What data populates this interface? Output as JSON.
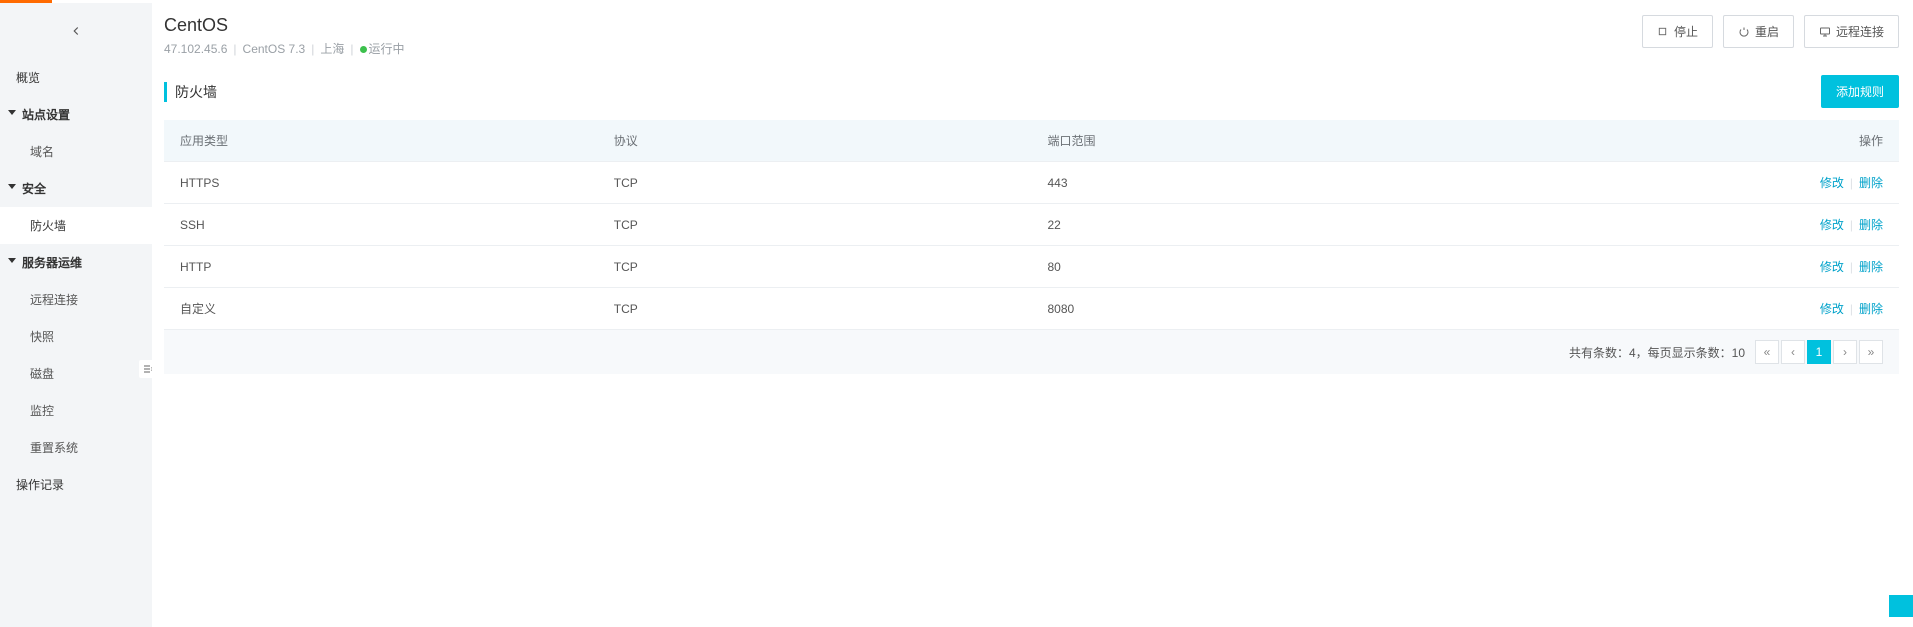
{
  "sidebar": {
    "items": {
      "overview": "概览",
      "site_settings": "站点设置",
      "domain": "域名",
      "security": "安全",
      "firewall": "防火墙",
      "server_ops": "服务器运维",
      "remote_connect": "远程连接",
      "snapshot": "快照",
      "disk": "磁盘",
      "monitoring": "监控",
      "reset_system": "重置系统",
      "oplog": "操作记录"
    }
  },
  "header": {
    "title": "CentOS",
    "ip": "47.102.45.6",
    "os": "CentOS 7.3",
    "region": "上海",
    "status_text": "运行中",
    "actions": {
      "stop": "停止",
      "restart": "重启",
      "remote": "远程连接"
    }
  },
  "panel": {
    "title": "防火墙",
    "add_rule": "添加规则"
  },
  "table": {
    "columns": {
      "app_type": "应用类型",
      "protocol": "协议",
      "port_range": "端口范围",
      "operation": "操作"
    },
    "actions": {
      "edit": "修改",
      "delete": "删除"
    },
    "rows": [
      {
        "app_type": "HTTPS",
        "protocol": "TCP",
        "port_range": "443"
      },
      {
        "app_type": "SSH",
        "protocol": "TCP",
        "port_range": "22"
      },
      {
        "app_type": "HTTP",
        "protocol": "TCP",
        "port_range": "80"
      },
      {
        "app_type": "自定义",
        "protocol": "TCP",
        "port_range": "8080"
      }
    ]
  },
  "pagination": {
    "summary": "共有条数：4，每页显示条数：10",
    "first": "«",
    "prev": "‹",
    "current": "1",
    "next": "›",
    "last": "»"
  }
}
